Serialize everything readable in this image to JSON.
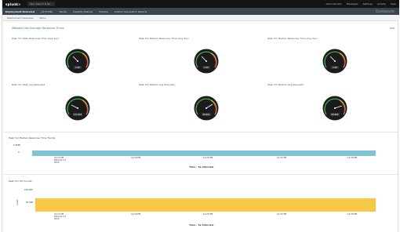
{
  "topbar": {
    "logo": "splunk>",
    "app_selector": "App: Search & Re...",
    "links": [
      "Administrator",
      "Messages",
      "Settings",
      "Activity",
      "Help"
    ]
  },
  "nav": {
    "items": [
      "Deployment Overview",
      "Job Profile",
      "Trends",
      "Capacity Planner",
      "Explore",
      "Custom Generation Reports"
    ],
    "brand": "Dashboards"
  },
  "subbar": {
    "items": [
      "Deployment Overview",
      "Menu"
    ]
  },
  "dashboard": {
    "title": "Website Hits Average Response Times",
    "edit_label": "Edit"
  },
  "panels": [
    {
      "label": "Peak 5m Peak Response Time (Avg Sec)",
      "value": "2.00"
    },
    {
      "label": "Peak 5m Median Response Time (Avg Sec)",
      "value": "2.00"
    },
    {
      "label": "Peak 5m Median Response Time (Avg Sec)",
      "value": "2.00"
    },
    {
      "label": "Peak 5m Peak Avg Requests",
      "value": "171,001"
    },
    {
      "label": "Peak 5m Median Avg Requests",
      "value": "58,601"
    },
    {
      "label": "Peak 5m Median Avg Requests",
      "value": "69,605"
    }
  ],
  "charts": {
    "response": {
      "title": "Peak 5m Median Response Time Trends",
      "ytick": "0.4000",
      "ymin_tick": "0",
      "xticks": [
        "12:11 PM",
        "12:18 PM",
        "12:25 PM",
        "12:32 PM",
        "12:39 PM"
      ],
      "xtick_sub": [
        "Wed Apr 21",
        "2015"
      ],
      "xlabel": "Time - 5s intervals",
      "color": "#7ec3d6"
    },
    "requests": {
      "title": "Peak 5m Hit Counts",
      "ytick_top": "100,000",
      "ytick_mid": "50,000",
      "ylabel": "count",
      "xticks": [
        "12:11 PM",
        "12:18 PM",
        "12:25 PM",
        "12:32 PM",
        "12:39 PM"
      ],
      "xtick_sub": [
        "Wed Apr 21",
        "2015"
      ],
      "xlabel": "Time - 5s intervals",
      "color": "#f6c845"
    }
  },
  "colors": {
    "topbar": "#141414",
    "navbar": "#3c444d",
    "accent_green": "#3a8c3a",
    "gauge_face": "#1b1b1b"
  }
}
